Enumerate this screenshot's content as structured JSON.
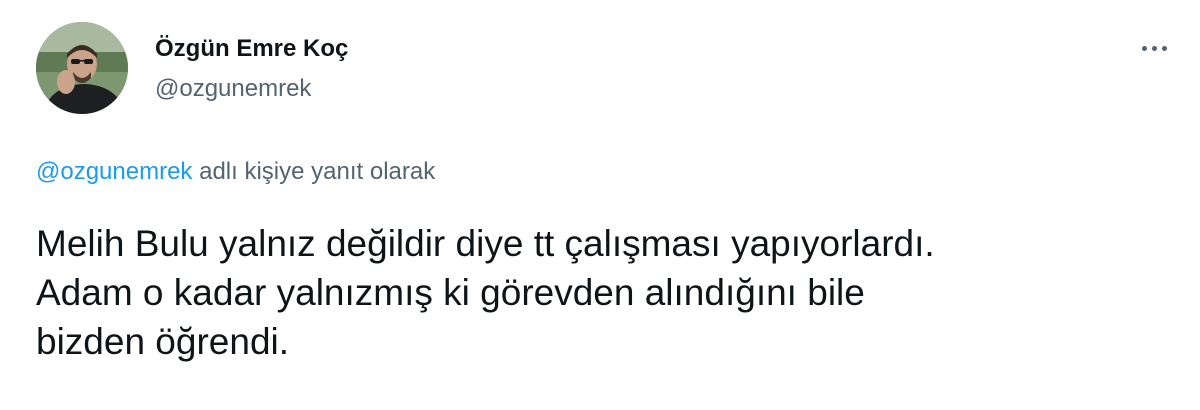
{
  "author": {
    "display_name": "Özgün Emre Koç",
    "handle": "@ozgunemrek",
    "avatar_icon": "profile-photo"
  },
  "menu": {
    "more_icon": "more-horizontal-icon"
  },
  "reply": {
    "to_handle": "@ozgunemrek",
    "suffix": "adlı kişiye yanıt olarak"
  },
  "tweet": {
    "lines": [
      "Melih Bulu yalnız değildir diye tt çalışması yapıyorlardı.",
      "Adam o kadar yalnızmış ki görevden alındığını bile",
      "bizden öğrendi."
    ]
  },
  "colors": {
    "text": "#0f1419",
    "secondary": "#536471",
    "link": "#1d9bf0",
    "background": "#ffffff"
  }
}
